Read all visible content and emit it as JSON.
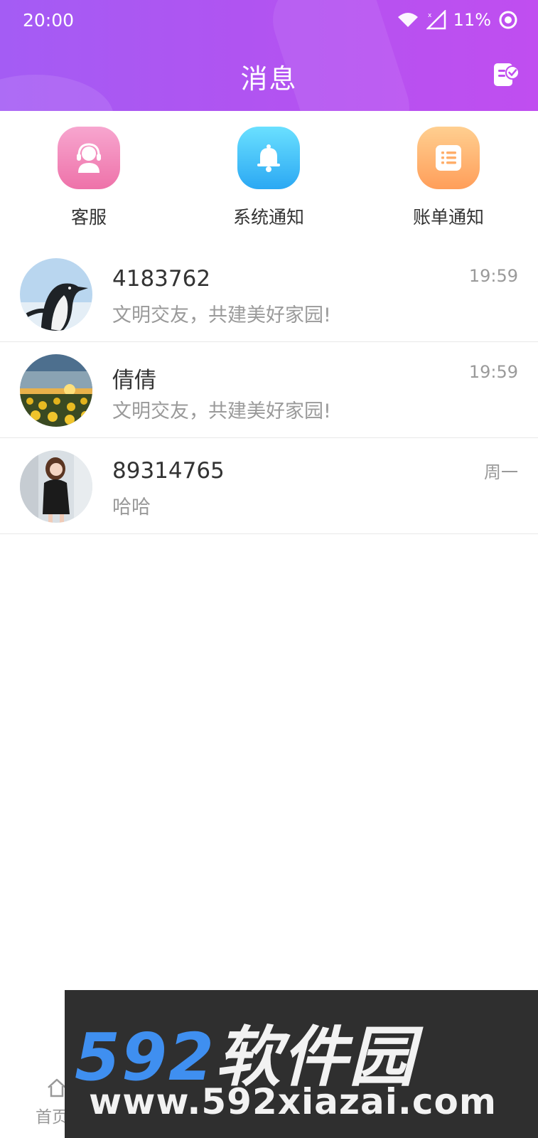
{
  "status_bar": {
    "time": "20:00",
    "battery": "11%"
  },
  "header": {
    "title": "消息"
  },
  "quick_actions": [
    {
      "label": "客服",
      "icon": "customer-service-icon",
      "color_from": "#f59ac7",
      "color_to": "#ee72a9"
    },
    {
      "label": "系统通知",
      "icon": "bell-icon",
      "color_from": "#66dcff",
      "color_to": "#2ba8f3"
    },
    {
      "label": "账单通知",
      "icon": "bill-icon",
      "color_from": "#ffc98a",
      "color_to": "#ff9e5a"
    }
  ],
  "conversations": [
    {
      "name": "4183762",
      "preview": "文明交友，共建美好家园!",
      "time": "19:59",
      "avatar": "penguin-avatar"
    },
    {
      "name": "倩倩",
      "preview": "文明交友，共建美好家园!",
      "time": "19:59",
      "avatar": "sunflower-avatar"
    },
    {
      "name": "89314765",
      "preview": "哈哈",
      "time": "周一",
      "avatar": "woman-avatar"
    }
  ],
  "tabbar": {
    "home_label": "首页"
  },
  "watermark": {
    "brand_num": "592",
    "brand_cn": "软件园",
    "url": "www.592xiazai.com"
  },
  "colors": {
    "header_start": "#a45cf4",
    "header_end": "#c04ef0",
    "divider": "#e8e8e8"
  }
}
